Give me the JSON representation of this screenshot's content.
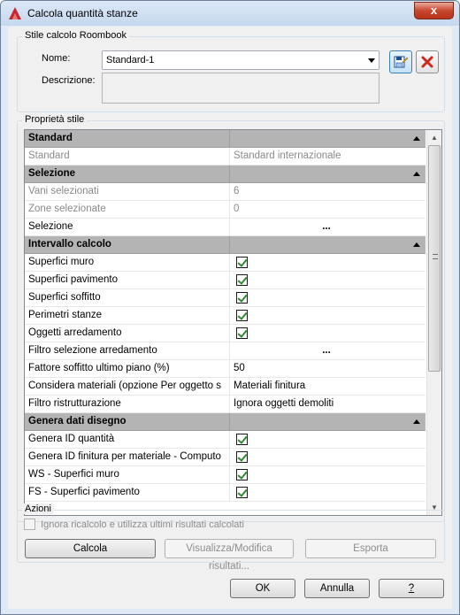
{
  "window": {
    "title": "Calcola quantità stanze",
    "close_glyph": "x"
  },
  "style_group": {
    "label": "Stile calcolo Roombook",
    "name_label": "Nome:",
    "name_value": "Standard-1",
    "description_label": "Descrizione:",
    "description_value": ""
  },
  "properties_group": {
    "label": "Proprietà stile",
    "rows": [
      {
        "type": "category",
        "name": "Standard"
      },
      {
        "type": "dim",
        "name": "Standard",
        "value": "Standard internazionale"
      },
      {
        "type": "category",
        "name": "Selezione"
      },
      {
        "type": "dim",
        "name": "Vani selezionati",
        "value": "6"
      },
      {
        "type": "dim",
        "name": "Zone selezionate",
        "value": "0"
      },
      {
        "type": "ellipsis",
        "name": "Selezione",
        "value": "..."
      },
      {
        "type": "category",
        "name": "Intervallo calcolo"
      },
      {
        "type": "check",
        "name": "Superfici muro",
        "checked": true
      },
      {
        "type": "check",
        "name": "Superfici pavimento",
        "checked": true
      },
      {
        "type": "check",
        "name": "Superfici soffitto",
        "checked": true
      },
      {
        "type": "check",
        "name": "Perimetri stanze",
        "checked": true
      },
      {
        "type": "check",
        "name": "Oggetti arredamento",
        "checked": true
      },
      {
        "type": "ellipsis",
        "name": "Filtro selezione arredamento",
        "value": "..."
      },
      {
        "type": "text",
        "name": "Fattore soffitto ultimo piano (%)",
        "value": "50"
      },
      {
        "type": "text",
        "name": "Considera materiali (opzione Per oggetto s",
        "value": "Materiali finitura"
      },
      {
        "type": "text",
        "name": "Filtro ristrutturazione",
        "value": "Ignora oggetti demoliti"
      },
      {
        "type": "category",
        "name": "Genera dati disegno"
      },
      {
        "type": "check",
        "name": "Genera ID quantità",
        "checked": true
      },
      {
        "type": "check",
        "name": "Genera ID finitura per materiale - Computo",
        "checked": true
      },
      {
        "type": "check",
        "name": "WS - Superfici muro",
        "checked": true
      },
      {
        "type": "check",
        "name": "FS - Superfici pavimento",
        "checked": true
      }
    ]
  },
  "actions_group": {
    "label": "Azioni",
    "ignore_checkbox_label": "Ignora ricalcolo e utilizza ultimi risultati calcolati",
    "ignore_checked": false,
    "calcola_label": "Calcola",
    "visualizza_label": "Visualizza/Modifica risultati...",
    "esporta_label": "Esporta"
  },
  "footer": {
    "ok_label": "OK",
    "annulla_label": "Annulla",
    "help_label": "?"
  },
  "icons": {
    "app": "autocad-a-icon",
    "save_style": "save-edit-icon",
    "delete_style": "red-x-icon"
  },
  "colors": {
    "accent_red": "#c8472f",
    "check_green": "#2c8a2c"
  }
}
